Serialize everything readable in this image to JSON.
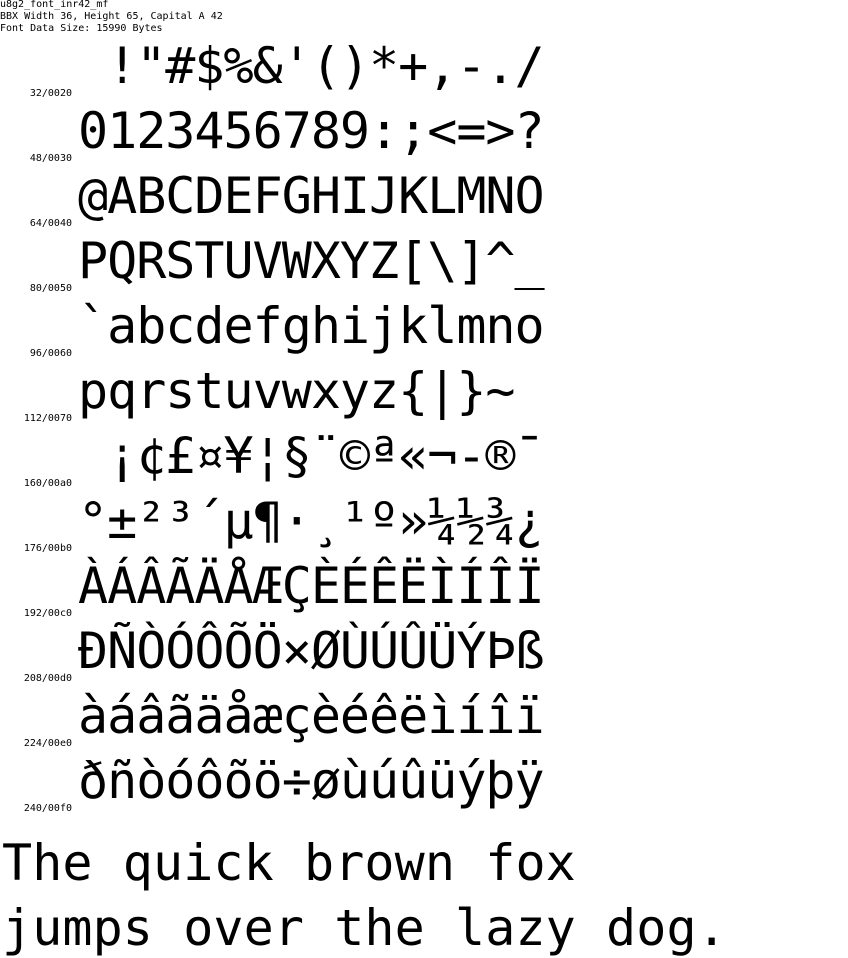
{
  "header": {
    "font_name": "u8g2_font_inr42_mf",
    "bbx_info": "BBX Width 36, Height 65, Capital A 42",
    "data_size": "Font Data Size: 15990 Bytes"
  },
  "rows": [
    {
      "code": "32/0020",
      "glyphs": " !\"#$%&'()*+,-./"
    },
    {
      "code": "48/0030",
      "glyphs": "0123456789:;<=>?"
    },
    {
      "code": "64/0040",
      "glyphs": "@ABCDEFGHIJKLMNO"
    },
    {
      "code": "80/0050",
      "glyphs": "PQRSTUVWXYZ[\\]^_"
    },
    {
      "code": "96/0060",
      "glyphs": "`abcdefghijklmno"
    },
    {
      "code": "112/0070",
      "glyphs": "pqrstuvwxyz{|}~"
    },
    {
      "code": "160/00a0",
      "glyphs": " ¡¢£¤¥¦§¨©ª«¬-®¯"
    },
    {
      "code": "176/00b0",
      "glyphs": "°±²³´µ¶·¸¹º»¼½¾¿"
    },
    {
      "code": "192/00c0",
      "glyphs": "ÀÁÂÃÄÅÆÇÈÉÊËÌÍÎÏ"
    },
    {
      "code": "208/00d0",
      "glyphs": "ÐÑÒÓÔÕÖ×ØÙÚÛÜÝÞß"
    },
    {
      "code": "224/00e0",
      "glyphs": "àáâãäåæçèéêëìíîï"
    },
    {
      "code": "240/00f0",
      "glyphs": "ðñòóôõö÷øùúûüýþÿ"
    }
  ],
  "sample": {
    "line1": "The quick brown fox",
    "line2": "jumps over the lazy dog."
  }
}
